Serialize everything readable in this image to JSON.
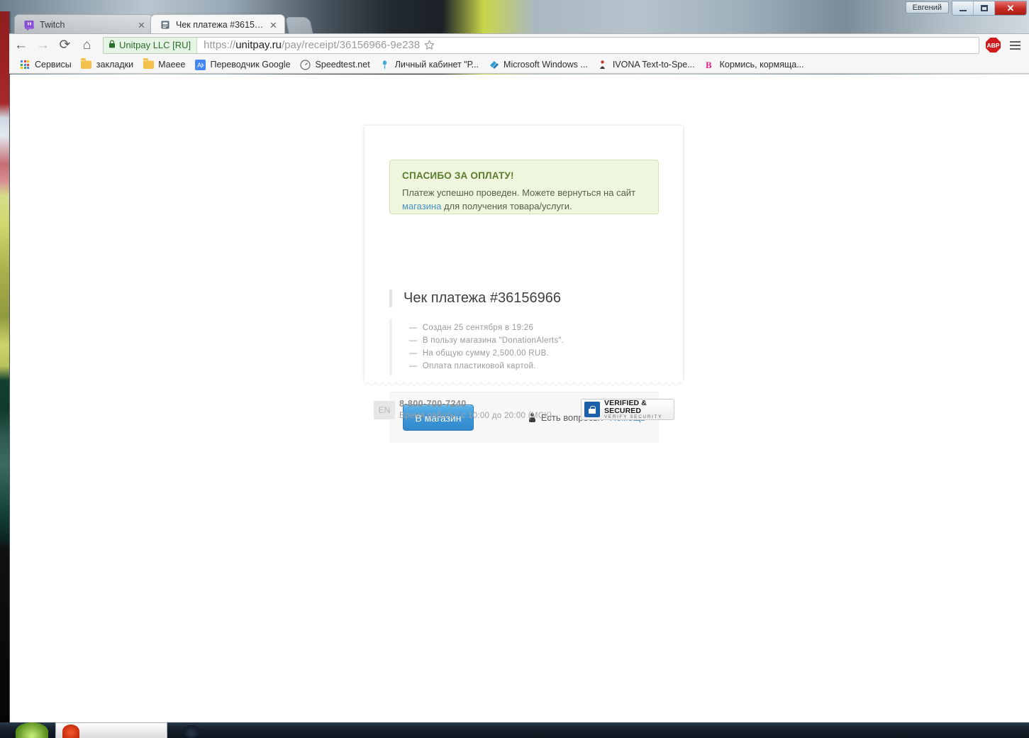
{
  "window": {
    "user_button": "Евгений",
    "minimize_label": "Свернуть",
    "maximize_label": "Развернуть",
    "close_label": "✕"
  },
  "browser": {
    "tabs": [
      {
        "title": "Twitch",
        "favicon": "twitch-icon",
        "active": false,
        "close_label": "✕"
      },
      {
        "title": "Чек платежа #36156966",
        "favicon": "receipt-icon",
        "active": true,
        "close_label": "✕"
      }
    ],
    "nav": {
      "back_label": "←",
      "forward_label": "→",
      "reload_label": "⟳",
      "home_label": "⌂"
    },
    "omnibox": {
      "ssl_label": "Unitpay LLC [RU]",
      "ssl_icon": "lock-icon",
      "url_scheme": "https://",
      "url_host": "unitpay.ru",
      "url_path": "/pay/receipt/36156966-9e238",
      "star_icon": "star-icon"
    },
    "extensions": {
      "adblock_label": "ABP",
      "menu_icon": "hamburger-menu-icon"
    },
    "bookmarks": [
      {
        "label": "Сервисы",
        "icon": "apps-grid-icon"
      },
      {
        "label": "закладки",
        "icon": "folder-icon"
      },
      {
        "label": "Маеее",
        "icon": "folder-icon"
      },
      {
        "label": "Переводчик Google",
        "icon": "google-translate-icon"
      },
      {
        "label": "Speedtest.net",
        "icon": "speedtest-icon"
      },
      {
        "label": "Личный кабинет \"Р...",
        "icon": "rostelecom-icon"
      },
      {
        "label": "Microsoft Windows ...",
        "icon": "microsoft-icon"
      },
      {
        "label": "IVONA Text-to-Spe...",
        "icon": "ivona-icon"
      },
      {
        "label": "Кормись, кормяща...",
        "icon": "vk-icon"
      }
    ]
  },
  "page": {
    "alert": {
      "title": "СПАСИБО ЗА ОПЛАТУ!",
      "text_before_link": "Платеж успешно проведен. Можете вернуться на сайт ",
      "link_text": "магазина",
      "text_after_link": " для получения товара/услуги."
    },
    "receipt": {
      "heading": "Чек платежа #36156966",
      "details": [
        "Создан 25 сентября в 19:26",
        "В пользу магазина \"DonationAlerts\".",
        "На общую сумму 2,500.00 RUB.",
        "Оплата пластиковой картой."
      ],
      "dash": "—"
    },
    "actions": {
      "shop_button": "В магазин",
      "support_icon": "person-icon",
      "support_question": "Есть вопросы?",
      "support_link": "Помощь"
    },
    "footer": {
      "lang": "EN",
      "phone": "8-800-700-7240",
      "hours": "Время работы: с 10:00 до 20:00 (МСК)",
      "seal_icon": "shield-lock-icon",
      "seal_line1": "VERIFIED & SECURED",
      "seal_line2": "VERIFY SECURITY"
    }
  },
  "colors": {
    "accent_blue": "#3d95d6",
    "link_blue": "#4a90c4",
    "alert_bg": "#eef7dd",
    "alert_border": "#d3e3b4",
    "alert_title": "#5d7b2e",
    "seal_blue": "#1d5fa8",
    "abp_red": "#d01c1c",
    "close_red": "#c32a22"
  }
}
